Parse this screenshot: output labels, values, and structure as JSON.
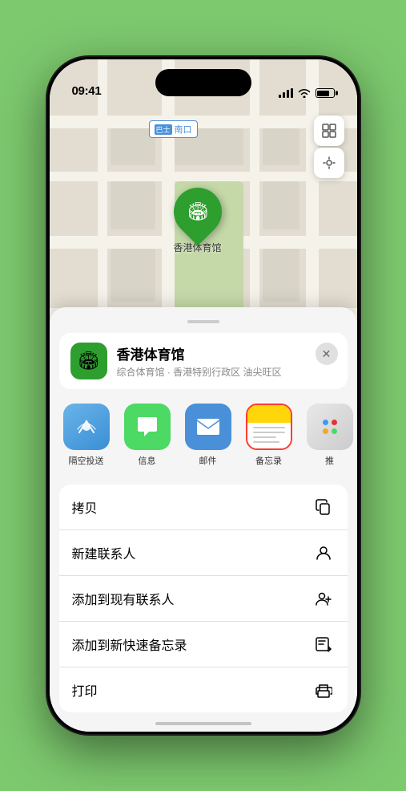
{
  "statusBar": {
    "time": "09:41",
    "timeIcon": "location-arrow"
  },
  "map": {
    "locationLabel": "南口",
    "locationLabelPrefix": "巴士"
  },
  "pin": {
    "label": "香港体育馆"
  },
  "locationCard": {
    "name": "香港体育馆",
    "subtitle": "综合体育馆 · 香港特别行政区 油尖旺区",
    "closeLabel": "×"
  },
  "shareApps": [
    {
      "id": "airdrop",
      "label": "隔空投送",
      "emoji": "📡"
    },
    {
      "id": "message",
      "label": "信息",
      "emoji": "💬"
    },
    {
      "id": "mail",
      "label": "邮件",
      "emoji": "✉️"
    },
    {
      "id": "notes",
      "label": "备忘录",
      "emoji": ""
    },
    {
      "id": "more",
      "label": "推",
      "emoji": ""
    }
  ],
  "actions": [
    {
      "id": "copy",
      "label": "拷贝",
      "icon": "copy"
    },
    {
      "id": "new-contact",
      "label": "新建联系人",
      "icon": "person"
    },
    {
      "id": "add-existing",
      "label": "添加到现有联系人",
      "icon": "person-add"
    },
    {
      "id": "quick-note",
      "label": "添加到新快速备忘录",
      "icon": "note"
    },
    {
      "id": "print",
      "label": "打印",
      "icon": "print"
    }
  ]
}
